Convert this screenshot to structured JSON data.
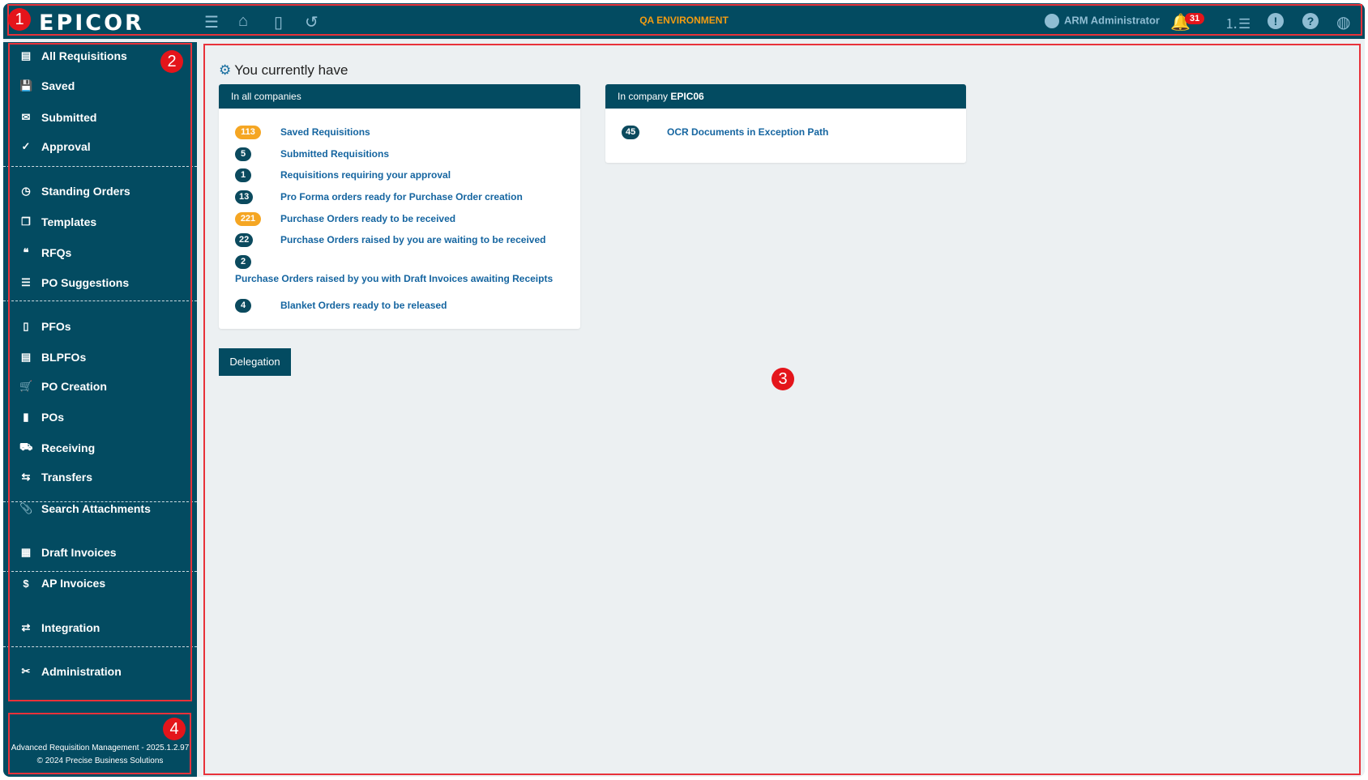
{
  "header": {
    "logo": "EPICOR",
    "environment": "QA ENVIRONMENT",
    "user": "ARM Administrator",
    "notifications": "31",
    "icons": [
      "menu-icon",
      "home-icon",
      "document-icon",
      "history-icon",
      "user-icon",
      "bell-icon",
      "ordered-list-icon",
      "alert-icon",
      "help-icon",
      "globe-icon"
    ]
  },
  "sidebar": {
    "items": [
      {
        "label": "All Requisitions",
        "icon": "▤"
      },
      {
        "label": "Saved",
        "icon": "💾"
      },
      {
        "label": "Submitted",
        "icon": "✉"
      },
      {
        "label": "Approval",
        "icon": "✓"
      },
      {
        "label": "Standing Orders",
        "icon": "◷"
      },
      {
        "label": "Templates",
        "icon": "❐"
      },
      {
        "label": "RFQs",
        "icon": "❝"
      },
      {
        "label": "PO Suggestions",
        "icon": "☰"
      },
      {
        "label": "PFOs",
        "icon": "▯"
      },
      {
        "label": "BLPFOs",
        "icon": "▤"
      },
      {
        "label": "PO Creation",
        "icon": "🛒"
      },
      {
        "label": "POs",
        "icon": "▮"
      },
      {
        "label": "Receiving",
        "icon": "⛟"
      },
      {
        "label": "Transfers",
        "icon": "⇆"
      },
      {
        "label": "Search Attachments",
        "icon": "📎"
      },
      {
        "label": "Draft Invoices",
        "icon": "▦"
      },
      {
        "label": "AP Invoices",
        "icon": "$"
      },
      {
        "label": "Integration",
        "icon": "⇄"
      },
      {
        "label": "Administration",
        "icon": "✂"
      }
    ],
    "footer_line1": "Advanced Requisition Management - 2025.1.2.97",
    "footer_line2": "© 2024 Precise Business Solutions"
  },
  "main": {
    "title": "You currently have",
    "all_companies": {
      "header": "In all companies",
      "rows": [
        {
          "count": "113",
          "label": "Saved Requisitions",
          "color": "#f5a623"
        },
        {
          "count": "5",
          "label": "Submitted Requisitions"
        },
        {
          "count": "1",
          "label": "Requisitions requiring your approval"
        },
        {
          "count": "13",
          "label": "Pro Forma orders ready for Purchase Order creation"
        },
        {
          "count": "221",
          "label": "Purchase Orders ready to be received",
          "color": "#f5a623"
        },
        {
          "count": "22",
          "label": "Purchase Orders raised by you are waiting to be received"
        },
        {
          "count": "2",
          "label": "Purchase Orders raised by you with Draft Invoices awaiting Receipts"
        },
        {
          "count": "4",
          "label": "Blanket Orders ready to be released"
        }
      ]
    },
    "company": {
      "header_prefix": "In company ",
      "company": "EPIC06",
      "rows": [
        {
          "count": "45",
          "label": "OCR Documents in Exception Path"
        }
      ]
    },
    "delegation": "Delegation"
  },
  "annotations": [
    "1",
    "2",
    "3",
    "4"
  ]
}
